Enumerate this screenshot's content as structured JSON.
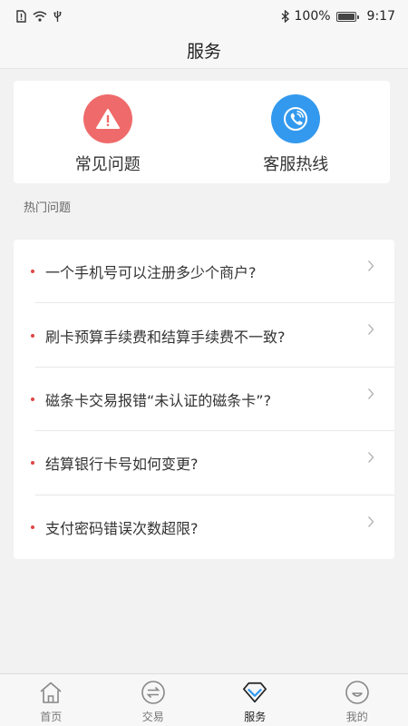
{
  "status_bar": {
    "battery": "100%",
    "time": "9:17",
    "icons": [
      "sim-alert-icon",
      "wifi-icon",
      "usb-icon",
      "bluetooth-icon",
      "battery-icon"
    ]
  },
  "header": {
    "title": "服务"
  },
  "quick_actions": [
    {
      "label": "常见问题",
      "icon": "warning-icon",
      "color": "#ef6a6a"
    },
    {
      "label": "客服热线",
      "icon": "phone-icon",
      "color": "#3399ee"
    }
  ],
  "hot_questions": {
    "title": "热门问题",
    "items": [
      {
        "text": "一个手机号可以注册多少个商户?"
      },
      {
        "text": "刷卡预算手续费和结算手续费不一致?"
      },
      {
        "text": "磁条卡交易报错“未认证的磁条卡”?"
      },
      {
        "text": "结算银行卡号如何变更?"
      },
      {
        "text": "支付密码错误次数超限?"
      }
    ]
  },
  "tab_bar": {
    "active": "服务",
    "tabs": [
      {
        "label": "首页",
        "icon": "home-icon"
      },
      {
        "label": "交易",
        "icon": "exchange-icon"
      },
      {
        "label": "服务",
        "icon": "diamond-icon"
      },
      {
        "label": "我的",
        "icon": "smiley-icon"
      }
    ]
  },
  "colors": {
    "accent_blue": "#3399ee",
    "alert_red": "#ef6a6a",
    "dot_red": "#e04545"
  }
}
